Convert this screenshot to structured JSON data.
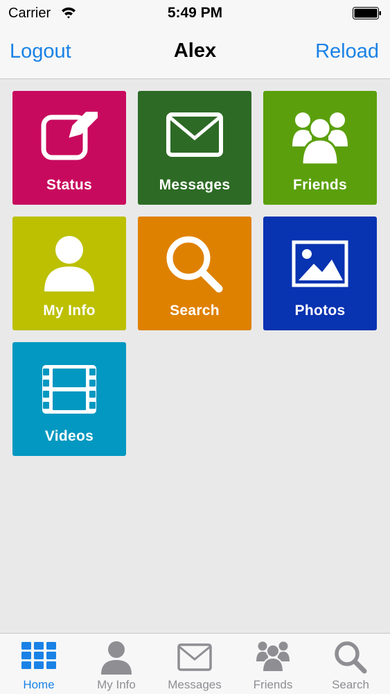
{
  "status_bar": {
    "carrier": "Carrier",
    "time": "5:49 PM"
  },
  "nav": {
    "left_label": "Logout",
    "title": "Alex",
    "right_label": "Reload"
  },
  "tiles": [
    {
      "label": "Status",
      "icon": "edit-icon",
      "color": "#c80a5e"
    },
    {
      "label": "Messages",
      "icon": "envelope-icon",
      "color": "#2d6a25"
    },
    {
      "label": "Friends",
      "icon": "group-icon",
      "color": "#5ba00c"
    },
    {
      "label": "My Info",
      "icon": "person-icon",
      "color": "#bcc000"
    },
    {
      "label": "Search",
      "icon": "magnifier-icon",
      "color": "#df8100"
    },
    {
      "label": "Photos",
      "icon": "image-icon",
      "color": "#0833b1"
    },
    {
      "label": "Videos",
      "icon": "film-icon",
      "color": "#0398c1"
    }
  ],
  "tabs": [
    {
      "label": "Home",
      "icon": "grid-icon",
      "active": true
    },
    {
      "label": "My Info",
      "icon": "person-icon",
      "active": false
    },
    {
      "label": "Messages",
      "icon": "envelope-icon",
      "active": false
    },
    {
      "label": "Friends",
      "icon": "group-icon",
      "active": false
    },
    {
      "label": "Search",
      "icon": "magnifier-icon",
      "active": false
    }
  ],
  "colors": {
    "accent": "#1a82e6",
    "inactive": "#8e8e93",
    "background": "#e9e9ea"
  }
}
